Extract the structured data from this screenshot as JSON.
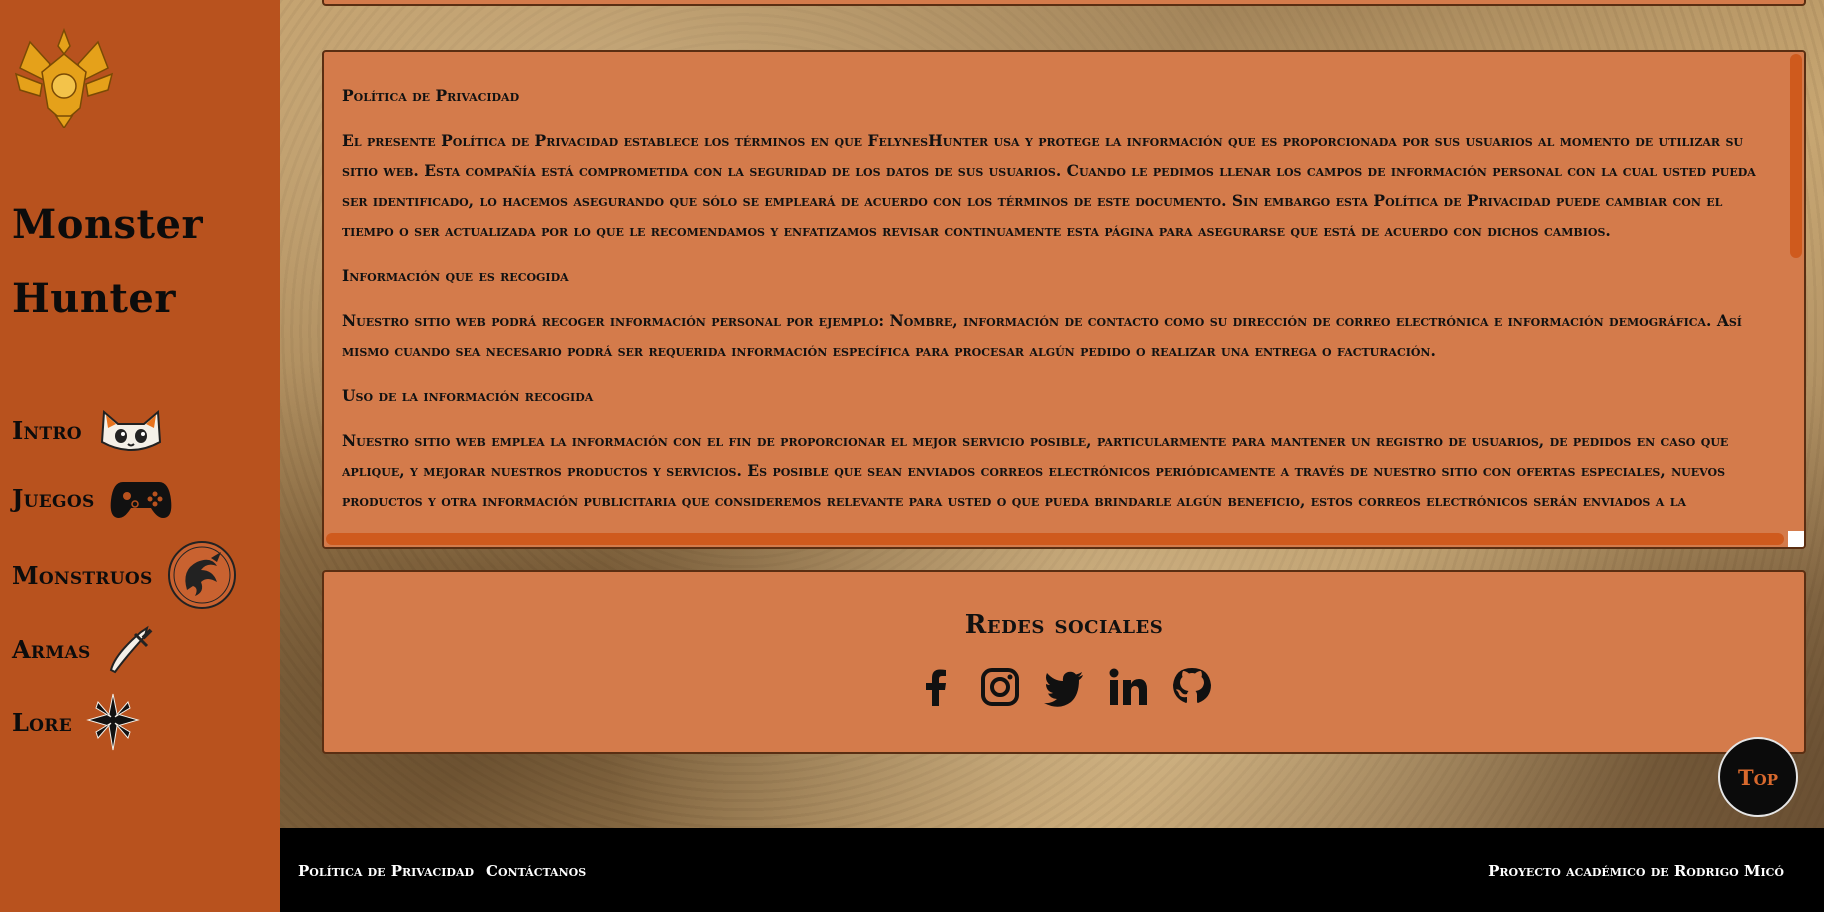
{
  "sidebar": {
    "brand_line1": "Monster",
    "brand_line2": "Hunter",
    "nav": [
      {
        "label": "Intro",
        "icon": "felyne-face-icon"
      },
      {
        "label": "Juegos",
        "icon": "gamepad-icon"
      },
      {
        "label": "Monstruos",
        "icon": "dragon-coin-icon"
      },
      {
        "label": "Armas",
        "icon": "sword-icon"
      },
      {
        "label": "Lore",
        "icon": "star-crest-icon"
      }
    ]
  },
  "privacy": {
    "title": "Política de Privacidad",
    "intro": "El presente Política de Privacidad establece los términos en que FelynesHunter usa y protege la información que es proporcionada por sus usuarios al momento de utilizar su sitio web. Esta compañía está comprometida con la seguridad de los datos de sus usuarios. Cuando le pedimos llenar los campos de información personal con la cual usted pueda ser identificado, lo hacemos asegurando que sólo se empleará de acuerdo con los términos de este documento. Sin embargo esta Política de Privacidad puede cambiar con el tiempo o ser actualizada por lo que le recomendamos y enfatizamos revisar continuamente esta página para asegurarse que está de acuerdo con dichos cambios.",
    "section1_title": "Información que es recogida",
    "section1_text": "Nuestro sitio web podrá recoger información personal por ejemplo: Nombre,  información de contacto como  su dirección de correo electrónica e información demográfica. Así mismo cuando sea necesario podrá ser requerida información específica para procesar algún pedido o realizar una entrega o facturación.",
    "section2_title": "Uso de la información recogida",
    "section2_text": "Nuestro sitio web emplea la información con el fin de proporcionar el mejor servicio posible, particularmente para mantener un registro de usuarios, de pedidos en caso que aplique, y mejorar nuestros productos y servicios.  Es posible que sean enviados correos electrónicos periódicamente a través de nuestro sitio con ofertas especiales, nuevos productos y otra información publicitaria que consideremos relevante para usted o que pueda brindarle algún beneficio, estos correos electrónicos serán enviados a la"
  },
  "social": {
    "title": "Redes sociales",
    "links": [
      "facebook-icon",
      "instagram-icon",
      "twitter-icon",
      "linkedin-icon",
      "github-icon"
    ]
  },
  "top_button": "Top",
  "footer": {
    "privacy_link": "Política de Privacidad",
    "contact_link": "Contáctanos",
    "credit": "Proyecto académico de Rodrigo Micó"
  },
  "colors": {
    "sidebar": "#b8521e",
    "panel": "#d47b4b",
    "accent": "#cf5a1d",
    "footer": "#000000"
  }
}
